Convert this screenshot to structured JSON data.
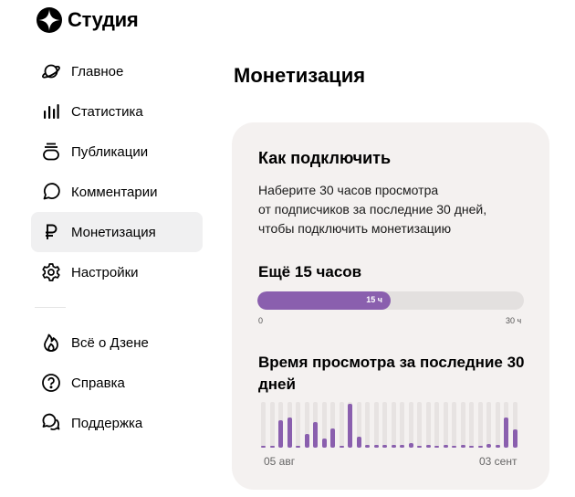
{
  "logo": {
    "text": "Студия"
  },
  "nav": {
    "items": [
      {
        "label": "Главное",
        "icon": "planet-icon",
        "active": false
      },
      {
        "label": "Статистика",
        "icon": "bar-chart-icon",
        "active": false
      },
      {
        "label": "Публикации",
        "icon": "stack-icon",
        "active": false
      },
      {
        "label": "Комментарии",
        "icon": "comment-icon",
        "active": false
      },
      {
        "label": "Монетизация",
        "icon": "ruble-icon",
        "active": true
      },
      {
        "label": "Настройки",
        "icon": "gear-icon",
        "active": false
      }
    ],
    "secondary": [
      {
        "label": "Всё о Дзене",
        "icon": "flame-icon"
      },
      {
        "label": "Справка",
        "icon": "help-icon"
      },
      {
        "label": "Поддержка",
        "icon": "chat-bubbles-icon"
      }
    ]
  },
  "page": {
    "title": "Монетизация"
  },
  "card": {
    "title": "Как подключить",
    "description_lines": [
      "Наберите 30 часов просмотра",
      "от подписчиков за последние 30 дней,",
      "чтобы подключить монетизацию"
    ],
    "remaining": "Ещё 15 часов",
    "progress": {
      "value_label": "15 ч",
      "min_label": "0",
      "max_label": "30 ч",
      "fraction": 0.5
    }
  },
  "colors": {
    "accent": "#8a5fae",
    "card_bg": "#f4f1f0",
    "track": "#e7e3e2"
  },
  "chart_data": {
    "type": "bar",
    "title": "Время просмотра за последние 30 дней",
    "x_tick_labels": [
      "05 авг",
      "03 сент"
    ],
    "values": [
      0.03,
      0.04,
      0.6,
      0.66,
      0.04,
      0.3,
      0.55,
      0.2,
      0.42,
      0.04,
      0.95,
      0.24,
      0.05,
      0.05,
      0.05,
      0.05,
      0.05,
      0.1,
      0.04,
      0.05,
      0.04,
      0.05,
      0.04,
      0.05,
      0.04,
      0.04,
      0.07,
      0.06,
      0.65,
      0.4
    ],
    "ylim": [
      0,
      1
    ],
    "grid": false
  }
}
